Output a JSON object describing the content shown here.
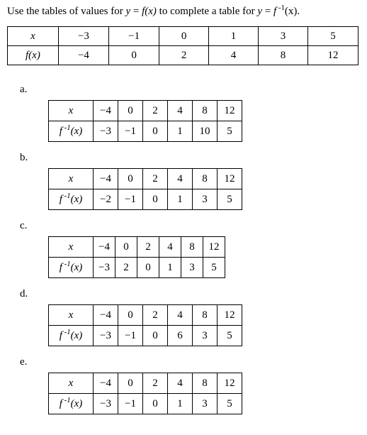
{
  "prompt_prefix": "Use the tables of values for ",
  "prompt_eq1_lhs": "y",
  "prompt_eq1_rhs": "f(x)",
  "prompt_mid": " to complete a table for ",
  "prompt_eq2_lhs": "y",
  "prompt_eq2_rhs_base": "f",
  "prompt_eq2_rhs_exp": "-1",
  "prompt_eq2_rhs_arg": "(x)",
  "prompt_end": ".",
  "main": {
    "row1hdr": "x",
    "row1": [
      "−3",
      "−1",
      "0",
      "1",
      "3",
      "5"
    ],
    "row2hdr": "f(x)",
    "row2": [
      "−4",
      "0",
      "2",
      "4",
      "8",
      "12"
    ]
  },
  "options": [
    {
      "label": "a.",
      "row1hdr": "x",
      "row1": [
        "−4",
        "0",
        "2",
        "4",
        "8",
        "12"
      ],
      "row2_prefix": "f",
      "row2_exp": "-1",
      "row2_suffix": "(x)",
      "row2": [
        "−3",
        "−1",
        "0",
        "1",
        "10",
        "5"
      ]
    },
    {
      "label": "b.",
      "row1hdr": "x",
      "row1": [
        "−4",
        "0",
        "2",
        "4",
        "8",
        "12"
      ],
      "row2_prefix": "f",
      "row2_exp": "-1",
      "row2_suffix": "(x)",
      "row2": [
        "−2",
        "−1",
        "0",
        "1",
        "3",
        "5"
      ]
    },
    {
      "label": "c.",
      "row1hdr": "x",
      "row1": [
        "−4",
        "0",
        "2",
        "4",
        "8",
        "12"
      ],
      "row2_prefix": "f",
      "row2_exp": "-1",
      "row2_suffix": "(x)",
      "row2": [
        "−3",
        "2",
        "0",
        "1",
        "3",
        "5"
      ]
    },
    {
      "label": "d.",
      "row1hdr": "x",
      "row1": [
        "−4",
        "0",
        "2",
        "4",
        "8",
        "12"
      ],
      "row2_prefix": "f",
      "row2_exp": "-1",
      "row2_suffix": "(x)",
      "row2": [
        "−3",
        "−1",
        "0",
        "6",
        "3",
        "5"
      ]
    },
    {
      "label": "e.",
      "row1hdr": "x",
      "row1": [
        "−4",
        "0",
        "2",
        "4",
        "8",
        "12"
      ],
      "row2_prefix": "f",
      "row2_exp": "-1",
      "row2_suffix": "(x)",
      "row2": [
        "−3",
        "−1",
        "0",
        "1",
        "3",
        "5"
      ]
    }
  ]
}
